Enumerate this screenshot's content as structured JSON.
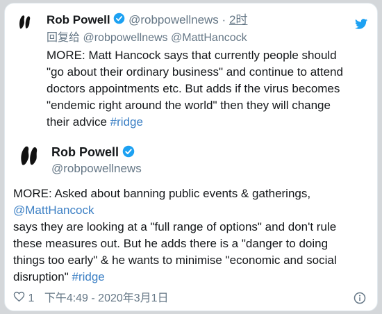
{
  "colors": {
    "accent": "#1da1f2",
    "link": "#3b7fc4",
    "text": "#14171a",
    "muted": "#657786"
  },
  "quoted_tweet": {
    "author_name": "Rob Powell",
    "handle": "@robpowellnews",
    "separator": "·",
    "time_ago": "2时",
    "reply_prefix": "回复给",
    "reply_handle_1": "@robpowellnews",
    "reply_handle_2": "@MattHancock",
    "lines": [
      "MORE: Matt Hancock says that currently people should",
      "\"go about their ordinary business\" and continue to attend",
      "doctors appointments etc. But adds if the virus becomes",
      "\"endemic right around the world\" then they will change",
      "their advice"
    ],
    "hashtag": "#ridge",
    "icon": "twitter-bird-icon"
  },
  "main_tweet": {
    "author_name": "Rob Powell",
    "handle": "@robpowellnews",
    "line1": "MORE: Asked about banning public events & gatherings,",
    "mention": "@MattHancock",
    "lines": [
      "says they are looking at a \"full range of options\" and don't rule",
      "these measures out. But he adds there is a \"danger to doing",
      "things too early\" & he wants to minimise \"economic and social",
      "disruption\""
    ],
    "hashtag": "#ridge",
    "like_count": "1",
    "timestamp": "下午4:49 - 2020年3月1日",
    "icons": [
      "heart-icon",
      "info-icon"
    ]
  }
}
